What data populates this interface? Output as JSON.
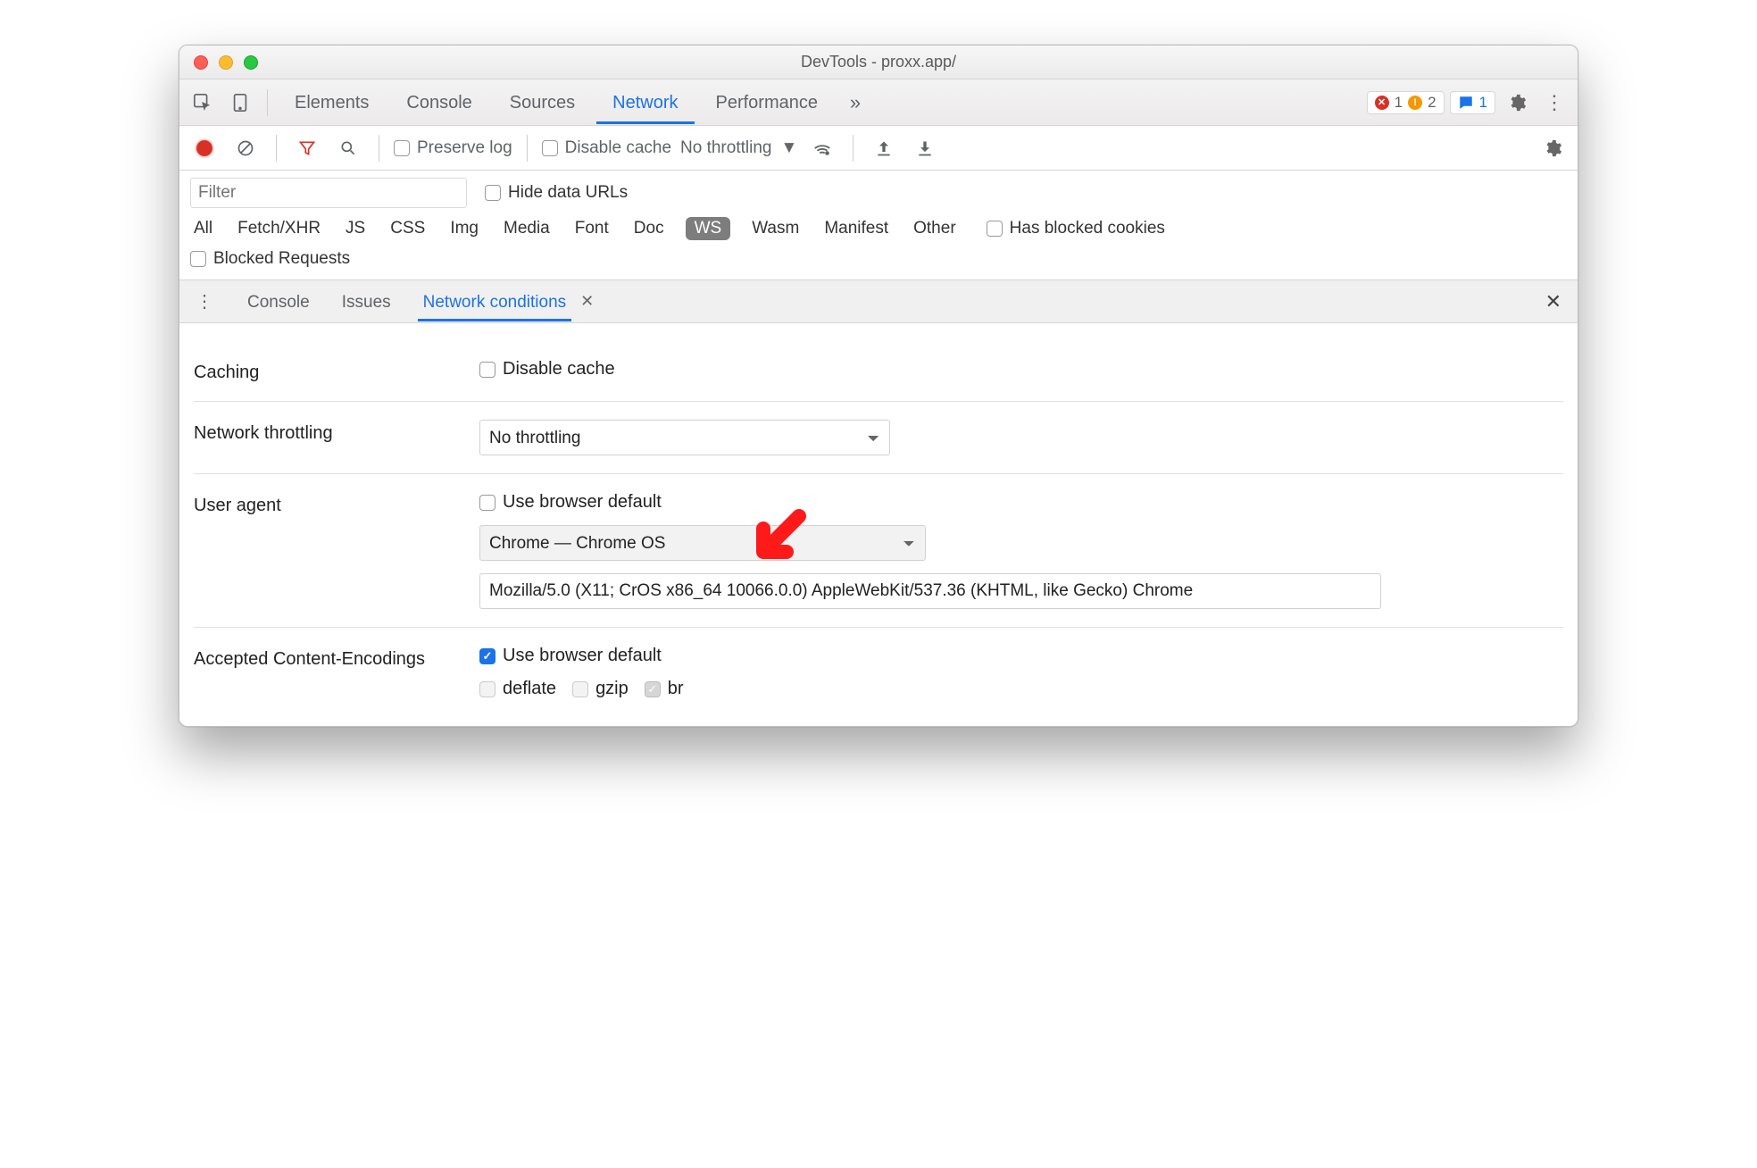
{
  "window": {
    "title": "DevTools - proxx.app/"
  },
  "tabs": {
    "items": [
      "Elements",
      "Console",
      "Sources",
      "Network",
      "Performance"
    ],
    "active": "Network",
    "more_icon": "chevrons-right",
    "errors": 1,
    "warnings": 2,
    "messages": 1
  },
  "toolbar": {
    "preserve_log": "Preserve log",
    "disable_cache": "Disable cache",
    "throttling": "No throttling"
  },
  "filters": {
    "placeholder": "Filter",
    "hide_data_urls": "Hide data URLs",
    "types": [
      "All",
      "Fetch/XHR",
      "JS",
      "CSS",
      "Img",
      "Media",
      "Font",
      "Doc",
      "WS",
      "Wasm",
      "Manifest",
      "Other"
    ],
    "has_blocked": "Has blocked cookies",
    "blocked_requests": "Blocked Requests"
  },
  "drawer": {
    "tabs": [
      "Console",
      "Issues",
      "Network conditions"
    ],
    "active": "Network conditions"
  },
  "conditions": {
    "caching_label": "Caching",
    "caching_disable": "Disable cache",
    "throttling_label": "Network throttling",
    "throttling_value": "No throttling",
    "ua_label": "User agent",
    "ua_default": "Use browser default",
    "ua_select": "Chrome — Chrome OS",
    "ua_string": "Mozilla/5.0 (X11; CrOS x86_64 10066.0.0) AppleWebKit/537.36 (KHTML, like Gecko) Chrome",
    "encodings_label": "Accepted Content-Encodings",
    "enc_default": "Use browser default",
    "enc_deflate": "deflate",
    "enc_gzip": "gzip",
    "enc_br": "br"
  }
}
